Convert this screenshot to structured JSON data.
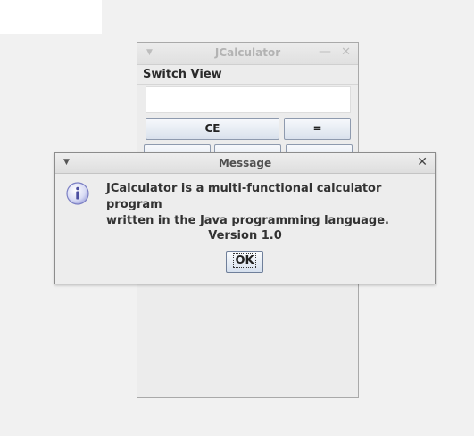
{
  "calculator": {
    "title": "JCalculator",
    "menu": {
      "switch_view": "Switch View"
    },
    "display_value": "",
    "buttons": {
      "ce": "CE",
      "equals": "="
    }
  },
  "dialog": {
    "title": "Message",
    "icon": "info-icon",
    "message_line1": "JCalculator is a multi-functional calculator program",
    "message_line2": "written in the Java programming language.",
    "version": "Version 1.0",
    "ok_label": "OK"
  }
}
